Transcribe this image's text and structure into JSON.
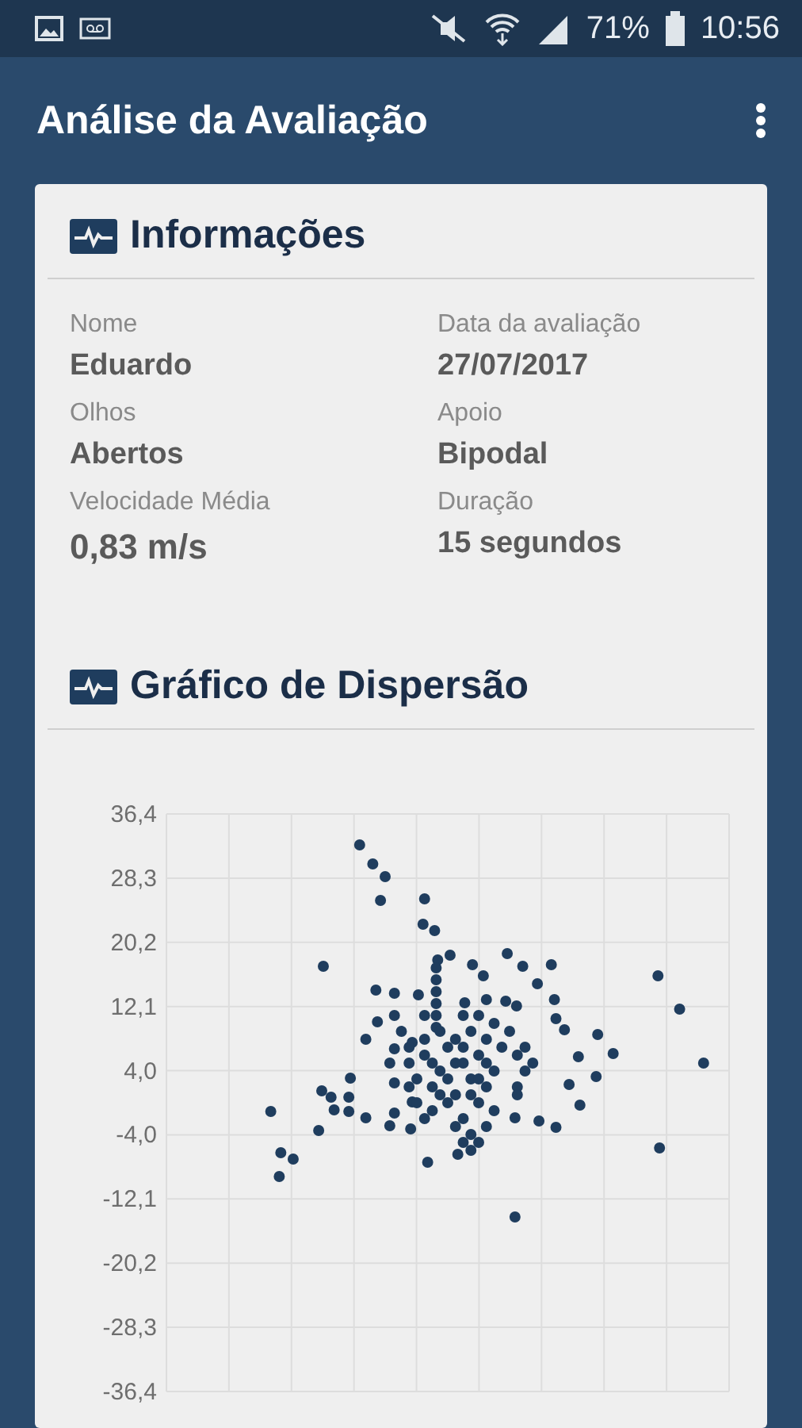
{
  "status_bar": {
    "battery": "71%",
    "time": "10:56"
  },
  "app_bar": {
    "title": "Análise da Avaliação"
  },
  "info": {
    "title": "Informações",
    "fields": [
      {
        "label": "Nome",
        "value": "Eduardo"
      },
      {
        "label": "Data da avaliação",
        "value": "27/07/2017"
      },
      {
        "label": "Olhos",
        "value": "Abertos"
      },
      {
        "label": "Apoio",
        "value": "Bipodal"
      },
      {
        "label": "Velocidade Média",
        "value": "0,83 m/s",
        "kind": "large"
      },
      {
        "label": "Duração",
        "value": "15 segundos"
      }
    ]
  },
  "scatter": {
    "title": "Gráfico de Dispersão",
    "y_axis_labels": [
      "36,4",
      "28,3",
      "20,2",
      "12,1",
      "4,0",
      "-4,0",
      "-12,1",
      "-20,2",
      "-28,3",
      "-36,4"
    ]
  }
}
